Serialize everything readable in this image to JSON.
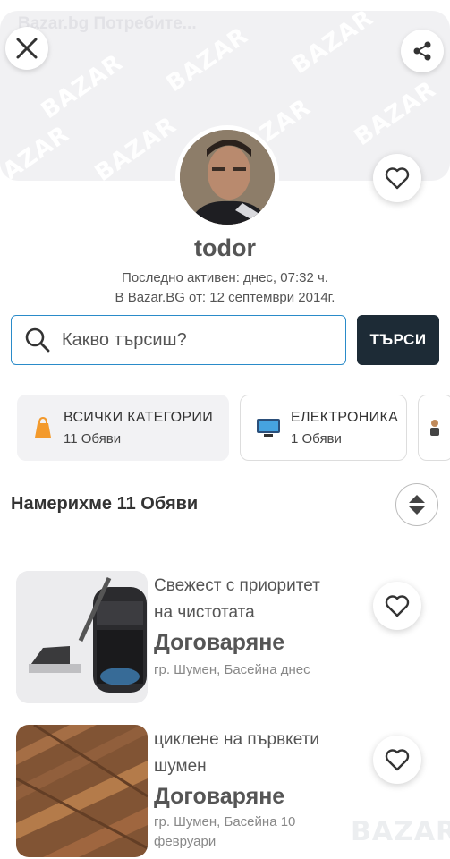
{
  "banner": {
    "title": "Bazar.bg Потребите..."
  },
  "icons": {
    "close": "close-icon",
    "share": "share-icon",
    "heart": "heart-icon",
    "search": "search-icon",
    "sort": "sort-icon"
  },
  "profile": {
    "username": "todor",
    "last_active": "Последно активен: днес, 07:32 ч.",
    "member_since": "В Bazar.BG от: 12 септември 2014г."
  },
  "search": {
    "placeholder": "Какво търсиш?",
    "button_label": "ТЪРСИ"
  },
  "categories": [
    {
      "title": "ВСИЧКИ КАТЕГОРИИ",
      "count": "11 Обяви"
    },
    {
      "title": "ЕЛЕКТРОНИКА",
      "count": "1 Обяви"
    }
  ],
  "results": {
    "found_label": "Намерихме 11 Обяви"
  },
  "listings": [
    {
      "title_line1": "Свежест с приоритет",
      "title_line2": "на чистотата",
      "price": "Договаряне",
      "location": "гр. Шумен, Басейна днес"
    },
    {
      "title_line1": "циклене на първкети",
      "title_line2": "шумен",
      "price": "Договаряне",
      "location": "гр. Шумен, Басейна 10 февруари"
    }
  ],
  "footer": {
    "logo": "BAZAR"
  },
  "colors": {
    "accent": "#2a8bc9",
    "button_dark": "#1d2b36",
    "category_bg": "#f2f2f4",
    "orange": "#f39a2c"
  }
}
